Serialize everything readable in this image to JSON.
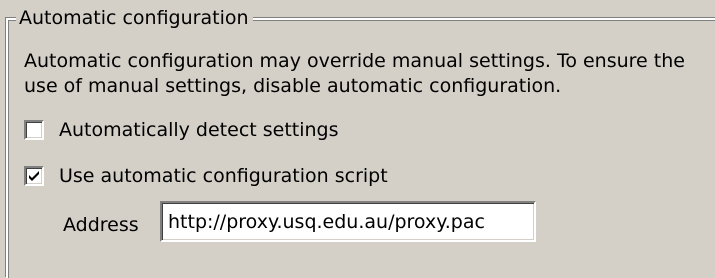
{
  "group": {
    "title": "Automatic configuration",
    "description_line1": "Automatic configuration may override manual settings.  To ensure the",
    "description_line2": "use of manual settings, disable automatic configuration."
  },
  "options": {
    "auto_detect": {
      "label": "Automatically detect settings",
      "checked": false
    },
    "use_script": {
      "label": "Use automatic configuration script",
      "checked": true
    }
  },
  "address": {
    "label": "Address",
    "value": "http://proxy.usq.edu.au/proxy.pac"
  },
  "icons": {
    "checkmark": "checkmark-icon"
  }
}
